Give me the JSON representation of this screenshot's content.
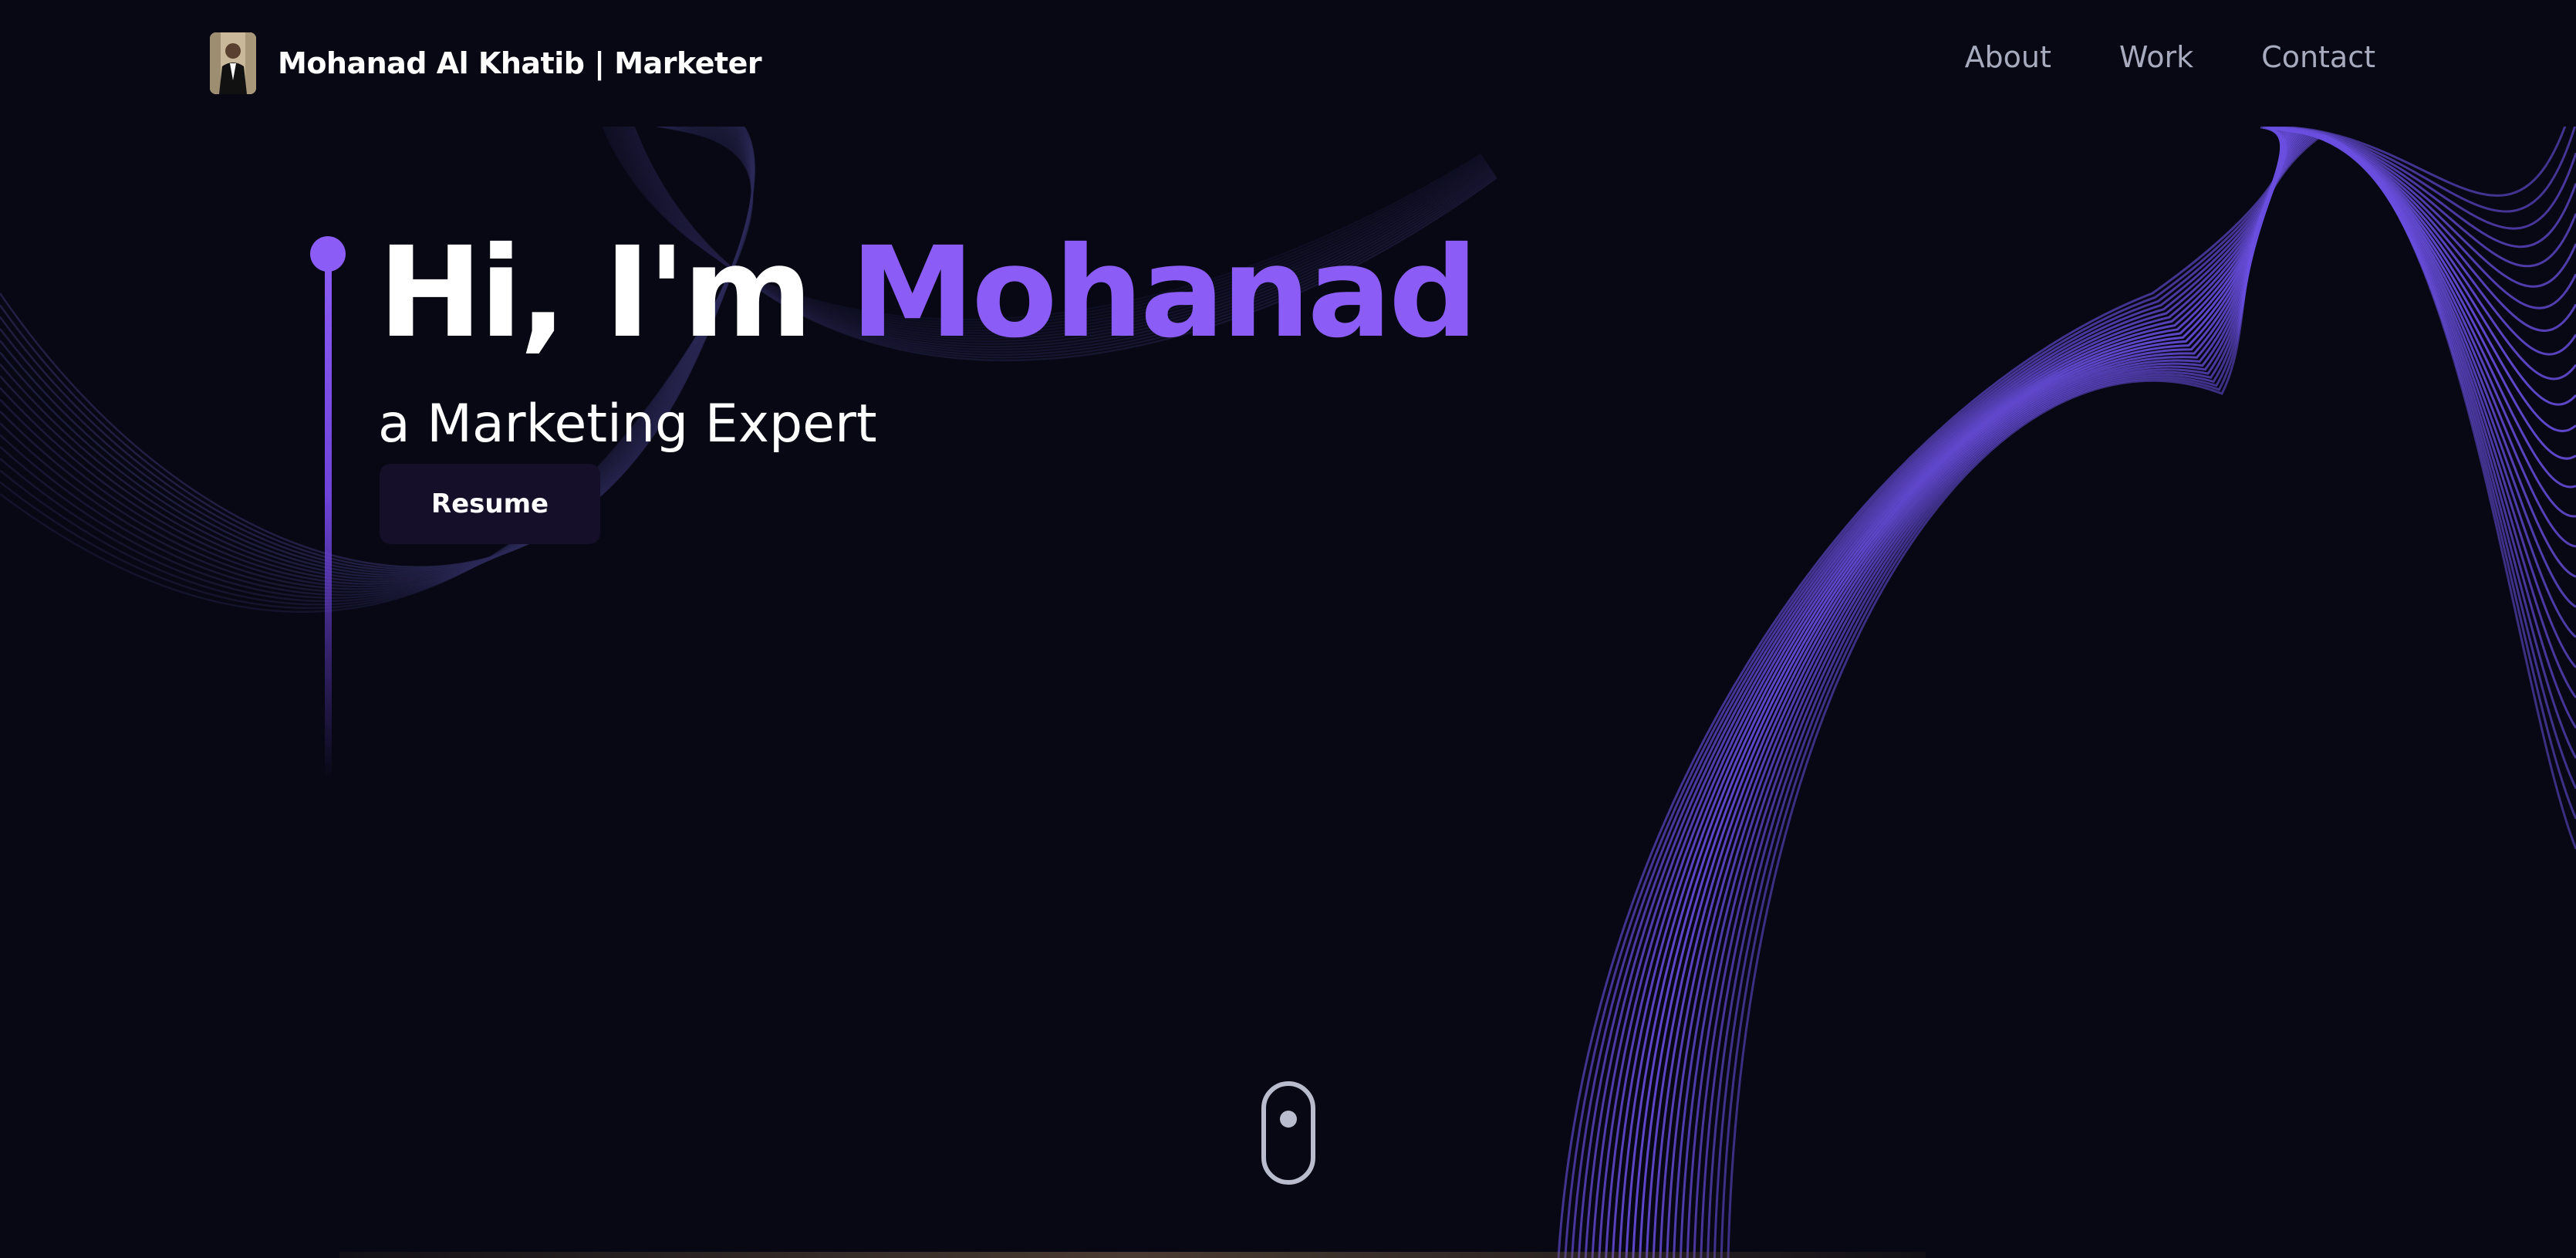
{
  "brand": {
    "name": "Mohanad Al Khatib  | Marketer",
    "avatar_icon": "profile-photo"
  },
  "nav": {
    "items": [
      {
        "label": "About"
      },
      {
        "label": "Work"
      },
      {
        "label": "Contact"
      }
    ]
  },
  "hero": {
    "greeting": "Hi, I'm ",
    "name": "Mohanad",
    "subtitle": "a Marketing Expert",
    "resume_label": "Resume"
  },
  "scroll": {
    "icon": "mouse-scroll-icon"
  },
  "colors": {
    "background": "#070814",
    "accent": "#8b5cf6",
    "nav_text": "#a7abbd",
    "button_bg": "#150f2a"
  }
}
